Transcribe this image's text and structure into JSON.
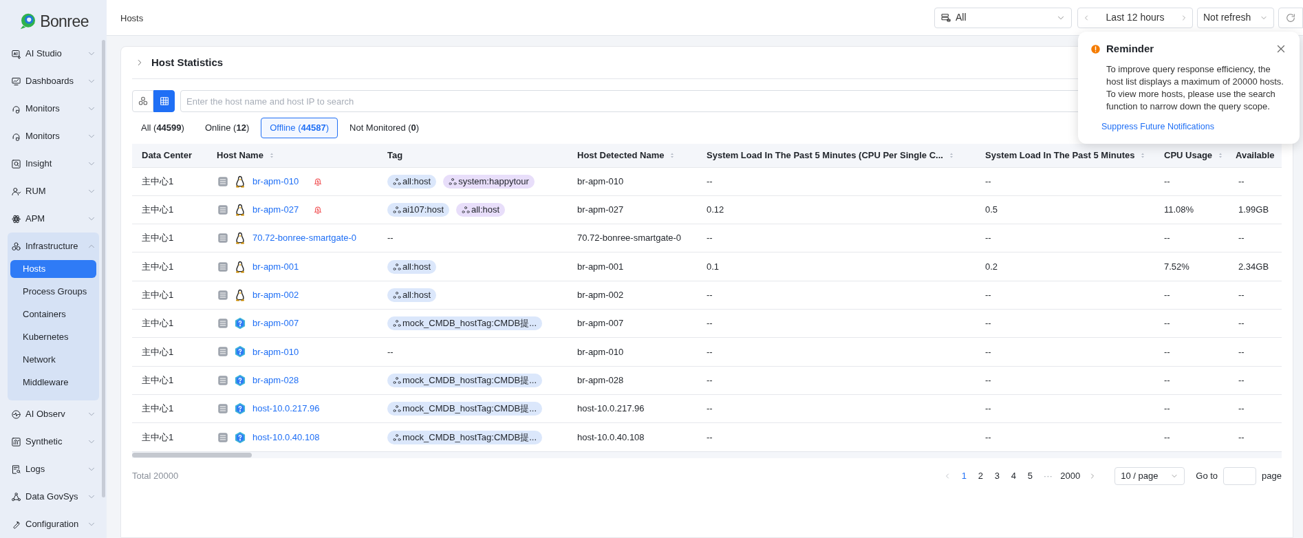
{
  "sidebar": {
    "logo": "Bonree",
    "items": [
      {
        "label": "AI Studio",
        "expanded": false
      },
      {
        "label": "Dashboards",
        "expanded": false
      },
      {
        "label": "Monitors",
        "expanded": false
      },
      {
        "label": "Monitors",
        "expanded": false
      },
      {
        "label": "Insight",
        "expanded": false
      },
      {
        "label": "RUM",
        "expanded": false
      },
      {
        "label": "APM",
        "expanded": false
      },
      {
        "label": "Infrastructure",
        "expanded": true,
        "children": [
          {
            "label": "Hosts",
            "selected": true
          },
          {
            "label": "Process Groups",
            "selected": false
          },
          {
            "label": "Containers",
            "selected": false
          },
          {
            "label": "Kubernetes",
            "selected": false
          },
          {
            "label": "Network",
            "selected": false
          },
          {
            "label": "Middleware",
            "selected": false
          }
        ]
      },
      {
        "label": "AI Observ",
        "expanded": false
      },
      {
        "label": "Synthetic",
        "expanded": false
      },
      {
        "label": "Logs",
        "expanded": false
      },
      {
        "label": "Data GovSys",
        "expanded": false
      },
      {
        "label": "Configuration",
        "expanded": false
      }
    ]
  },
  "header": {
    "title": "Hosts",
    "data_source": "All",
    "time_range": "Last 12 hours",
    "refresh": "Not refresh"
  },
  "section": {
    "title": "Host Statistics",
    "expanded": false
  },
  "view_toggle": [
    {
      "kind": "topology",
      "selected": false
    },
    {
      "kind": "table",
      "selected": true
    }
  ],
  "search": {
    "placeholder": "Enter the host name and host IP to search"
  },
  "filter_tabs": [
    {
      "label": "All (**44599**)",
      "selected": false
    },
    {
      "label": "Online (**12**)",
      "selected": false
    },
    {
      "label": "Offline (**44587**)",
      "selected": true
    },
    {
      "label": "Not Monitored (**0**)",
      "selected": false
    }
  ],
  "table": {
    "columns": [
      {
        "label": "Data Center",
        "sortable": false
      },
      {
        "label": "Host Name",
        "sortable": true
      },
      {
        "label": "Tag",
        "sortable": false
      },
      {
        "label": "Host Detected Name",
        "sortable": true
      },
      {
        "label": "System Load In The Past 5 Minutes (CPU Per Single C...",
        "sortable": true
      },
      {
        "label": "System Load In The Past 5 Minutes",
        "sortable": true
      },
      {
        "label": "CPU Usage",
        "sortable": true
      },
      {
        "label": "Available"
      }
    ],
    "rows": [
      {
        "data_center": "主中心1",
        "host_name": "br-apm-010",
        "kind": "linux",
        "alert": true,
        "tags": [
          {
            "label": "all:host",
            "color": "#dbe7fb"
          },
          {
            "label": "system:happytour",
            "color": "#e8defa"
          }
        ],
        "detected_name": "br-apm-010",
        "load_per_cpu": "--",
        "load": "--",
        "cpu_usage": "--",
        "available": "--"
      },
      {
        "data_center": "主中心1",
        "host_name": "br-apm-027",
        "kind": "linux",
        "alert": true,
        "tags": [
          {
            "label": "ai107:host",
            "color": "#dbe7fb"
          },
          {
            "label": "all:host",
            "color": "#e8defa"
          }
        ],
        "detected_name": "br-apm-027",
        "load_per_cpu": "0.12",
        "load": "0.5",
        "cpu_usage": "11.08%",
        "available": "1.99GB"
      },
      {
        "data_center": "主中心1",
        "host_name": "70.72-bonree-smartgate-0",
        "kind": "linux",
        "alert": false,
        "tag_text": "--",
        "detected_name": "70.72-bonree-smartgate-0",
        "load_per_cpu": "--",
        "load": "--",
        "cpu_usage": "--",
        "available": "--"
      },
      {
        "data_center": "主中心1",
        "host_name": "br-apm-001",
        "kind": "linux",
        "alert": false,
        "tags": [
          {
            "label": "all:host",
            "color": "#dbe7fb"
          }
        ],
        "detected_name": "br-apm-001",
        "load_per_cpu": "0.1",
        "load": "0.2",
        "cpu_usage": "7.52%",
        "available": "2.34GB"
      },
      {
        "data_center": "主中心1",
        "host_name": "br-apm-002",
        "kind": "linux",
        "alert": false,
        "tags": [
          {
            "label": "all:host",
            "color": "#dbe7fb"
          }
        ],
        "detected_name": "br-apm-002",
        "load_per_cpu": "--",
        "load": "--",
        "cpu_usage": "--",
        "available": "--"
      },
      {
        "data_center": "主中心1",
        "host_name": "br-apm-007",
        "kind": "unknown",
        "alert": false,
        "tags": [
          {
            "label": "mock_CMDB_hostTag:CMDB提...",
            "color": "#dbe7fb"
          }
        ],
        "detected_name": "br-apm-007",
        "load_per_cpu": "--",
        "load": "--",
        "cpu_usage": "--",
        "available": "--"
      },
      {
        "data_center": "主中心1",
        "host_name": "br-apm-010",
        "kind": "unknown",
        "alert": false,
        "tag_text": "--",
        "detected_name": "br-apm-010",
        "load_per_cpu": "--",
        "load": "--",
        "cpu_usage": "--",
        "available": "--"
      },
      {
        "data_center": "主中心1",
        "host_name": "br-apm-028",
        "kind": "unknown",
        "alert": false,
        "tags": [
          {
            "label": "mock_CMDB_hostTag:CMDB提...",
            "color": "#dbe7fb"
          }
        ],
        "detected_name": "br-apm-028",
        "load_per_cpu": "--",
        "load": "--",
        "cpu_usage": "--",
        "available": "--"
      },
      {
        "data_center": "主中心1",
        "host_name": "host-10.0.217.96",
        "kind": "unknown",
        "alert": false,
        "tags": [
          {
            "label": "mock_CMDB_hostTag:CMDB提...",
            "color": "#dbe7fb"
          }
        ],
        "detected_name": "host-10.0.217.96",
        "load_per_cpu": "--",
        "load": "--",
        "cpu_usage": "--",
        "available": "--"
      },
      {
        "data_center": "主中心1",
        "host_name": "host-10.0.40.108",
        "kind": "unknown",
        "alert": false,
        "tags": [
          {
            "label": "mock_CMDB_hostTag:CMDB提...",
            "color": "#dbe7fb"
          }
        ],
        "detected_name": "host-10.0.40.108",
        "load_per_cpu": "--",
        "load": "--",
        "cpu_usage": "--",
        "available": "--"
      }
    ]
  },
  "footer": {
    "total": "Total 20000",
    "pages": [
      {
        "label": "1",
        "selected": true
      },
      {
        "label": "2",
        "selected": false
      },
      {
        "label": "3",
        "selected": false
      },
      {
        "label": "4",
        "selected": false
      },
      {
        "label": "5",
        "selected": false
      }
    ],
    "ellipsis": "···",
    "last_page": "2000",
    "page_size": "10 / page",
    "goto_label": "Go to",
    "goto_suffix": "page"
  },
  "reminder": {
    "title": "Reminder",
    "message": "To improve query response efficiency, the host list displays a maximum of 20000 hosts. To view more hosts, please use the search function to narrow down the query scope.",
    "link": "Suppress Future Notifications"
  }
}
